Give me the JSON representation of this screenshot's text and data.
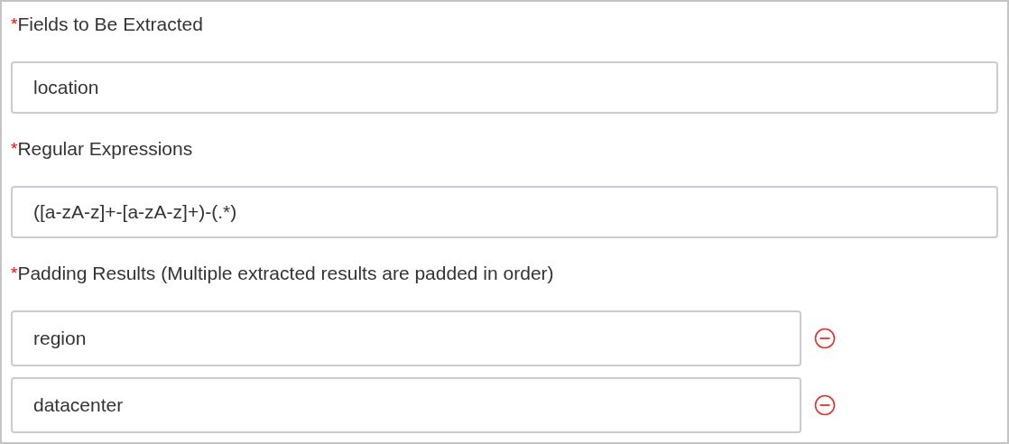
{
  "sections": [
    {
      "kind": "single",
      "required": true,
      "marker": "*",
      "label": "Fields to Be Extracted",
      "values": [
        "location"
      ]
    },
    {
      "kind": "single",
      "required": true,
      "marker": "*",
      "label": "Regular Expressions",
      "values": [
        "([a-zA-z]+-[a-zA-z]+)-(.*)"
      ]
    },
    {
      "kind": "list",
      "required": true,
      "marker": "*",
      "label": "Padding Results (Multiple extracted results are padded in order)",
      "values": [
        "region",
        "datacenter"
      ]
    }
  ]
}
